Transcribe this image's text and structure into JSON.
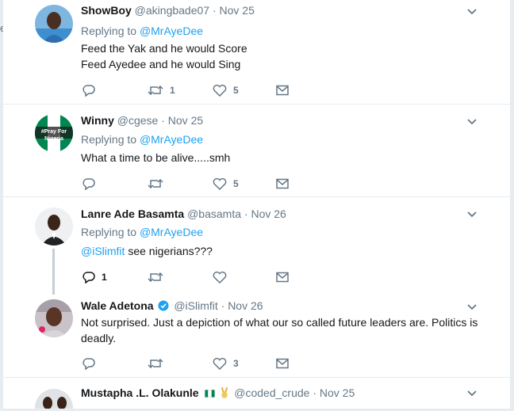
{
  "colors": {
    "accent": "#1da1f2",
    "muted": "#657786",
    "text": "#14171a",
    "border": "#e6ecf0",
    "flag_green": "#008751"
  },
  "left_mark": "e",
  "tweets": [
    {
      "name": "ShowBoy",
      "handle": "@akingbade07",
      "date": "· Nov 25",
      "replying_prefix": "Replying to ",
      "replying_to": "@MrAyeDee",
      "lines": [
        "Feed the Yak and he would Score",
        "Feed Ayedee and he would Sing"
      ],
      "retweets": "1",
      "likes": "5"
    },
    {
      "name": "Winny",
      "handle": "@cgese",
      "date": "· Nov 25",
      "avatar_text": "#Pray For Nigeria",
      "replying_prefix": "Replying to ",
      "replying_to": "@MrAyeDee",
      "lines": [
        "What a time to be alive.....smh"
      ],
      "retweets": "",
      "likes": "5"
    },
    {
      "name": "Lanre Ade Basamta",
      "handle": "@basamta",
      "date": "· Nov 26",
      "replying_prefix": "Replying to ",
      "replying_to": "@MrAyeDee",
      "mention": "@iSlimfit",
      "text_after_mention": " see nigerians???",
      "replies": "1",
      "likes": ""
    },
    {
      "name": "Wale Adetona",
      "handle": "@iSlimfit",
      "date": "· Nov 26",
      "verified": true,
      "lines": [
        "Not surprised. Just a depiction of what our so called future leaders are. Politics is",
        "deadly."
      ],
      "likes": "3"
    },
    {
      "name": "Mustapha .L. Olakunle",
      "emoji_icons": [
        "nigeria-flag-icon",
        "victory-hand-icon"
      ],
      "handle": "@coded_crude",
      "date": "· Nov 25"
    }
  ]
}
